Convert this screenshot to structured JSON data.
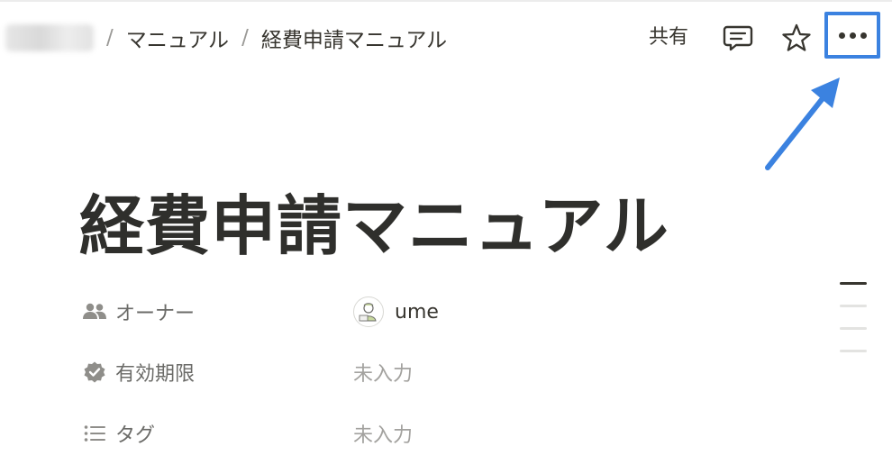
{
  "breadcrumb": {
    "items": [
      "マニュアル",
      "経費申請マニュアル"
    ],
    "separator": "/"
  },
  "topbar": {
    "share_label": "共有",
    "icons": [
      "comment-icon",
      "star-icon",
      "more-icon"
    ]
  },
  "title": "経費申請マニュアル",
  "properties": [
    {
      "label": "オーナー",
      "icon": "people-icon",
      "value": "ume"
    },
    {
      "label": "有効期限",
      "icon": "verified-badge-icon",
      "value": "未入力"
    },
    {
      "label": "タグ",
      "icon": "list-icon",
      "value": "未入力"
    }
  ],
  "colors": {
    "highlight": "#3b82e0",
    "text": "#37352f",
    "muted": "#a3a29f"
  }
}
